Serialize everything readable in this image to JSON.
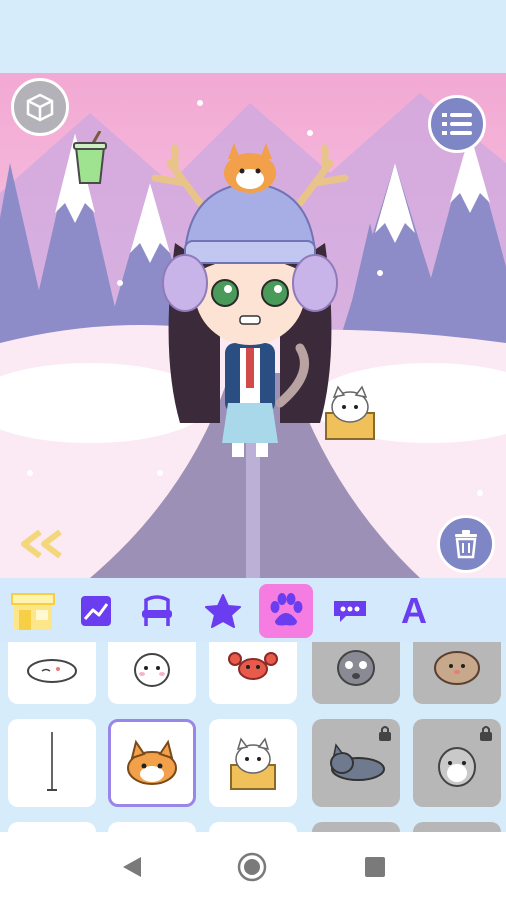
{
  "tabs": [
    {
      "name": "shop",
      "icon": "shop-icon",
      "active": false
    },
    {
      "name": "background",
      "icon": "picture-icon",
      "active": false
    },
    {
      "name": "furniture",
      "icon": "chair-icon",
      "active": false
    },
    {
      "name": "stickers",
      "icon": "star-icon",
      "active": false
    },
    {
      "name": "pets",
      "icon": "paw-icon",
      "active": true
    },
    {
      "name": "speech",
      "icon": "speech-bubble-icon",
      "active": false
    },
    {
      "name": "text",
      "icon": "text-icon",
      "label": "A",
      "active": false
    }
  ],
  "items": [
    {
      "name": "sleeping-hamster",
      "locked": false,
      "selected": false
    },
    {
      "name": "white-bunny",
      "locked": false,
      "selected": false
    },
    {
      "name": "red-crab",
      "locked": false,
      "selected": false
    },
    {
      "name": "gray-cat",
      "locked": true,
      "selected": false
    },
    {
      "name": "brown-hedgehog",
      "locked": true,
      "selected": false
    },
    {
      "name": "stick",
      "locked": false,
      "selected": false
    },
    {
      "name": "corgi",
      "locked": false,
      "selected": true
    },
    {
      "name": "cat-in-box",
      "locked": false,
      "selected": false
    },
    {
      "name": "lying-gray-cat",
      "locked": true,
      "selected": false
    },
    {
      "name": "hamster",
      "locked": true,
      "selected": false
    }
  ],
  "colors": {
    "accent": "#6a3df0",
    "active_tab": "#f57de2",
    "scene_button": "#7f86c6",
    "panel": "#d6ecfb"
  }
}
